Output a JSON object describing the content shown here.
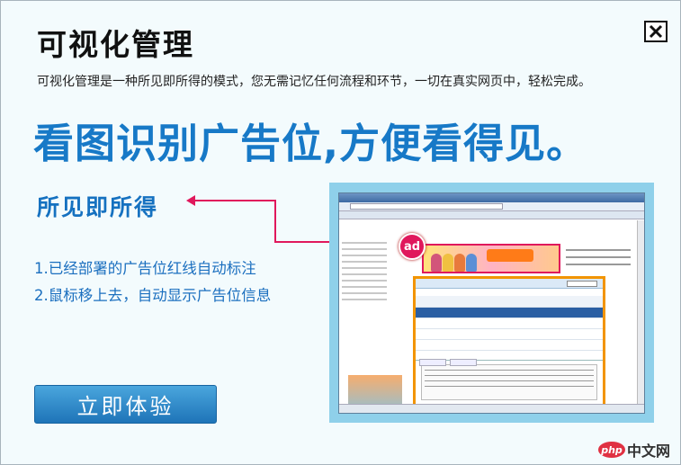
{
  "dialog": {
    "title": "可视化管理",
    "subtitle": "可视化管理是一种所见即所得的模式，您无需记忆任何流程和环节，一切在真实网页中，轻松完成。",
    "headline": "看图识别广告位,方便看得见。",
    "feature_title": "所见即所得",
    "steps": [
      "1.已经部署的广告位红线自动标注",
      "2.鼠标移上去，自动显示广告位信息"
    ],
    "cta_label": "立即体验",
    "ad_badge": "ad",
    "close_icon": "close-icon"
  },
  "colors": {
    "headline": "#1779c7",
    "accent_pink": "#e0185c",
    "popup_border": "#f29400",
    "cta": "#2a86c6"
  },
  "watermark": {
    "logo": "php",
    "text": "中文网"
  }
}
